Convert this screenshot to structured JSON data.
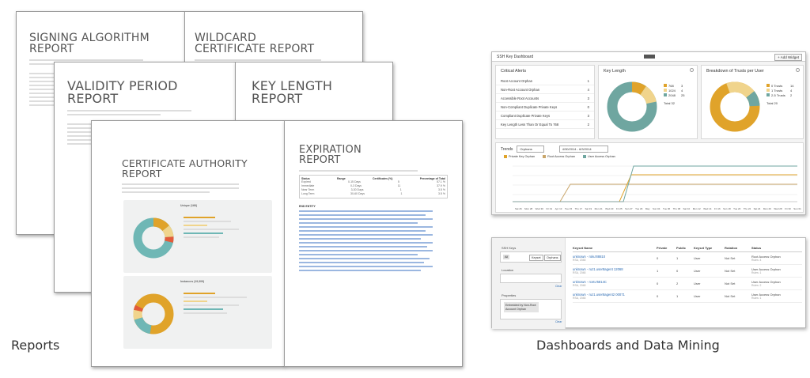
{
  "reports": {
    "signing": {
      "title": "SIGNING ALGORITHM REPORT"
    },
    "wildcard": {
      "title": "WILDCARD CERTIFICATE REPORT"
    },
    "validity": {
      "title": "VALIDITY PERIOD REPORT"
    },
    "keylength": {
      "title": "KEY LENGTH REPORT"
    },
    "ca": {
      "title": "CERTIFICATE AUTHORITY REPORT",
      "donut1_label": "Unique (166)",
      "donut2_label": "Instances (19,309)"
    },
    "expiration": {
      "title": "EXPIRATION REPORT",
      "table_headers": [
        "Status",
        "Range",
        "Certificates (%)",
        "Percentage of Total"
      ],
      "rows": [
        [
          "Expired",
          "0-15 Days",
          "5",
          "57.1 %"
        ],
        [
          "Immediate",
          "0-3 Days",
          "11",
          "37.9 %"
        ],
        [
          "Near Term",
          "3-30 Days",
          "1",
          "3.5 %"
        ],
        [
          "Long Term",
          "30-60 Days",
          "1",
          "3.5 %"
        ]
      ],
      "end_entity": "END ENTITY"
    }
  },
  "dashboard": {
    "title": "SSH Key Dashboard",
    "add_widget": "+ Add Widget",
    "critical_alerts": {
      "title": "Critical Alerts",
      "rows": [
        {
          "label": "Root Account Orphan",
          "count": "1"
        },
        {
          "label": "Non-Root Account Orphan",
          "count": "4"
        },
        {
          "label": "Accessible Root Accounts",
          "count": "3"
        },
        {
          "label": "Non-Compliant Duplicate Private Keys",
          "count": "0"
        },
        {
          "label": "Compliant Duplicate Private Keys",
          "count": "3"
        },
        {
          "label": "Key Length Less Than Or Equal To 768",
          "count": "2"
        }
      ]
    },
    "key_length": {
      "title": "Key Length",
      "legend": [
        {
          "name": "768",
          "value": "3",
          "color": "#e0a32a"
        },
        {
          "name": "1024",
          "value": "4",
          "color": "#f0d48c"
        },
        {
          "name": "2048",
          "value": "25",
          "color": "#6fa6a0"
        }
      ],
      "total": "Total 32"
    },
    "trusts": {
      "title": "Breakdown of Trusts per User",
      "legend": [
        {
          "name": "0 Trusts",
          "value": "14",
          "color": "#e0a32a"
        },
        {
          "name": "1 Trusts",
          "value": "4",
          "color": "#f0d48c"
        },
        {
          "name": "2-5 Trusts",
          "value": "2",
          "color": "#6fa6a0"
        }
      ],
      "total": "Total 20"
    },
    "trends": {
      "title": "Trends",
      "select": "Orphans",
      "date_range": "4/30/2014 - 6/3/2014",
      "legend": [
        {
          "name": "Private Key Orphan",
          "color": "#e0a32a"
        },
        {
          "name": "Root Access Orphan",
          "color": "#c9a66b"
        },
        {
          "name": "User Access Orphan",
          "color": "#6fa6a0"
        }
      ],
      "x_labels": [
        "Sat 26",
        "Mon 28",
        "Wed 30",
        "Fri 01",
        "Apr 13",
        "Tue 15",
        "Thu 17",
        "Sat 19",
        "Mon 21",
        "Wed 23",
        "Fri 25",
        "Sun 27",
        "Tue 29",
        "May",
        "Sun 04",
        "Tue 06",
        "Thu 08",
        "Sat 10",
        "Mon 12",
        "Wed 14",
        "Fri 16",
        "Sun 18",
        "Tue 20",
        "Thu 22",
        "Sat 24",
        "Mon 26",
        "Wed 28",
        "Fri 30",
        "Sun 01"
      ]
    }
  },
  "mining": {
    "ssh_keys": "SSH Keys",
    "tag": "All",
    "filters": [
      "Keyset",
      "Orphans"
    ],
    "location": "Location",
    "properties": "Properties",
    "property_value": "Embedded by Non-Root Account Orphan",
    "clear": "Clear",
    "headers": [
      "Keyset Name",
      "Private",
      "Public",
      "Keyset Type",
      "Rotation",
      "Status"
    ],
    "rows": [
      {
        "name": "unknown - roku'88810",
        "sub": "RSA, 2048",
        "private": "0",
        "public": "1",
        "type": "User",
        "rotation": "Not Set",
        "status": "Root Access Orphan",
        "status_sub": "Rules: 4"
      },
      {
        "name": "unknown - ruz1.user8agent 12068",
        "sub": "RSA, 2048",
        "private": "1",
        "public": "0",
        "type": "User",
        "rotation": "Not Set",
        "status": "User Access Orphan",
        "status_sub": "Rules: 1"
      },
      {
        "name": "unknown - rcetu'5814C",
        "sub": "RSA, 2048",
        "private": "0",
        "public": "2",
        "type": "User",
        "rotation": "Not Set",
        "status": "User Access Orphan",
        "status_sub": "Rules: 2"
      },
      {
        "name": "unknown - ruz1.user8agent2 00071",
        "sub": "RSA, 2048",
        "private": "0",
        "public": "1",
        "type": "User",
        "rotation": "Not Set",
        "status": "User Access Orphan",
        "status_sub": "Rules: 1"
      }
    ]
  },
  "captions": {
    "left": "Reports",
    "right": "Dashboards and Data Mining"
  }
}
